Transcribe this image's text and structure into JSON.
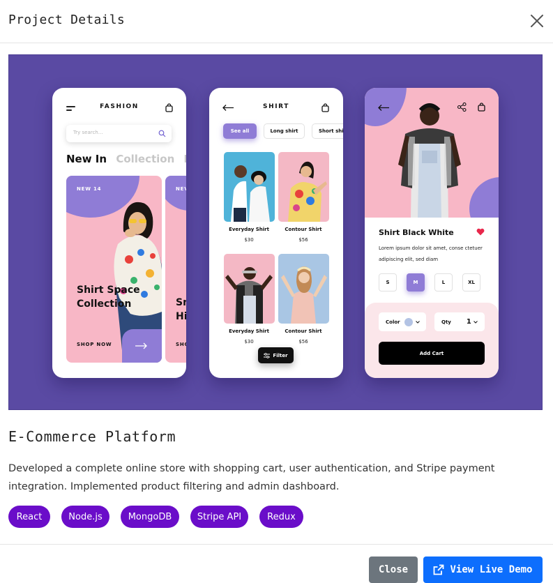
{
  "modal": {
    "title": "Project Details",
    "close_icon": "close-icon"
  },
  "hero_image": {
    "background_color": "#5a4aa3",
    "accent_color": "#8f7cd6",
    "pink_color": "#f8b7c6",
    "phone1": {
      "brand": "FASHION",
      "search_placeholder": "Try search...",
      "tabs": [
        "New In",
        "Collection",
        "De"
      ],
      "card_badge": "NEW 14",
      "card_headline": "Shirt Space Collection",
      "card_cta": "SHOP NOW",
      "card2_badge": "NEV",
      "card2_text_1": "Sn",
      "card2_text_2": "Hi",
      "card2_cta": "SHO"
    },
    "phone2": {
      "title": "SHIRT",
      "chips": [
        "See all",
        "Long shirt",
        "Short shir"
      ],
      "products": [
        {
          "name": "Everyday Shirt",
          "price": "$30"
        },
        {
          "name": "Contour Shirt",
          "price": "$56"
        },
        {
          "name": "Everyday Shirt",
          "price": "$30"
        },
        {
          "name": "Contour Shirt",
          "price": "$56"
        }
      ],
      "filter_label": "Filter"
    },
    "phone3": {
      "product_name": "Shirt Black White",
      "description": "Lorem ipsum dolor sit amet, conse ctetuer adipiscing elit, sed diam",
      "sizes": [
        "S",
        "M",
        "L",
        "XL"
      ],
      "selected_size": "M",
      "color_label": "Color",
      "qty_label": "Qty",
      "qty_value": "1",
      "add_cart_label": "Add Cart"
    }
  },
  "project": {
    "title": "E-Commerce Platform",
    "description": "Developed a complete online store with shopping cart, user authentication, and Stripe payment integration. Implemented product filtering and admin dashboard.",
    "tags": [
      "React",
      "Node.js",
      "MongoDB",
      "Stripe API",
      "Redux"
    ],
    "tag_color": "#6a0dc9"
  },
  "footer": {
    "close_label": "Close",
    "demo_label": "View Live Demo",
    "demo_icon": "external-link-icon",
    "close_color": "#6c757d",
    "demo_color": "#0d6efd"
  }
}
